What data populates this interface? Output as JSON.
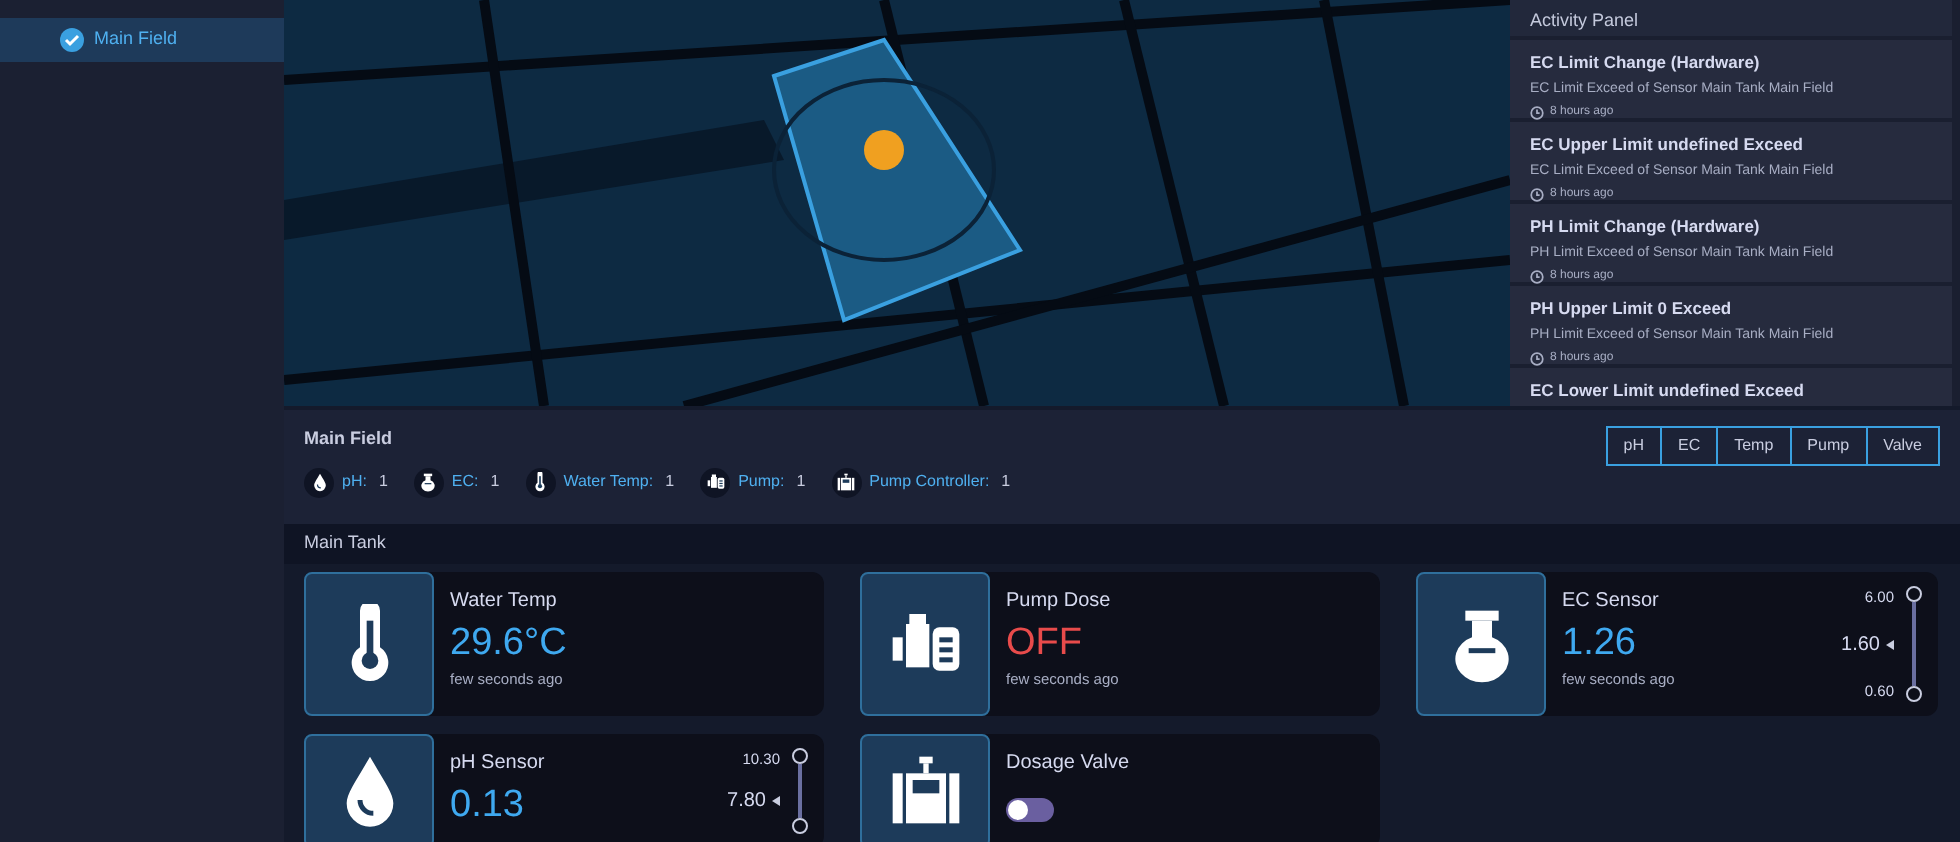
{
  "sidebar": {
    "items": [
      {
        "label": "Main Field",
        "selected": true
      }
    ]
  },
  "activity_panel": {
    "title": "Activity Panel",
    "items": [
      {
        "title": "EC Limit Change (Hardware)",
        "description": "EC Limit Exceed of Sensor Main Tank  Main Field",
        "time": "8 hours ago"
      },
      {
        "title": "EC Upper Limit undefined Exceed",
        "description": "EC Limit Exceed of Sensor Main Tank  Main Field",
        "time": "8 hours ago"
      },
      {
        "title": "PH Limit Change (Hardware)",
        "description": "PH Limit Exceed of Sensor Main Tank  Main Field",
        "time": "8 hours ago"
      },
      {
        "title": "PH Upper Limit 0 Exceed",
        "description": "PH Limit Exceed of Sensor Main Tank  Main Field",
        "time": "8 hours ago"
      },
      {
        "title": "EC Lower Limit undefined Exceed"
      }
    ]
  },
  "field": {
    "title": "Main Field",
    "counts": [
      {
        "kind": "drop",
        "label": "pH:",
        "count": "1"
      },
      {
        "kind": "flask",
        "label": "EC:",
        "count": "1"
      },
      {
        "kind": "thermometer",
        "label": "Water Temp:",
        "count": "1"
      },
      {
        "kind": "pump",
        "label": "Pump:",
        "count": "1"
      },
      {
        "kind": "valve",
        "label": "Pump Controller:",
        "count": "1"
      }
    ],
    "filters": [
      {
        "label": "pH",
        "selected": false
      },
      {
        "label": "EC",
        "selected": false
      },
      {
        "label": "Temp",
        "selected": false
      },
      {
        "label": "Pump",
        "selected": false
      },
      {
        "label": "Valve",
        "selected": false
      }
    ]
  },
  "tank": {
    "title": "Main Tank",
    "cards": [
      {
        "kind": "thermometer",
        "title": "Water Temp",
        "value": "29.6°C",
        "alert": false,
        "time": "few seconds ago"
      },
      {
        "kind": "pump",
        "title": "Pump Dose",
        "value": "OFF",
        "alert": true,
        "time": "few seconds ago"
      },
      {
        "kind": "flask",
        "title": "EC Sensor",
        "value": "1.26",
        "alert": false,
        "time": "few seconds ago",
        "max": "6.00",
        "setpoint": "1.60",
        "min": "0.60",
        "level": 1
      },
      {
        "kind": "drop",
        "title": "pH Sensor",
        "value": "0.13",
        "alert": false,
        "max": "10.30",
        "setpoint": "7.80",
        "level": 1
      },
      {
        "kind": "valve",
        "title": "Dosage Valve",
        "on": false
      }
    ]
  }
}
